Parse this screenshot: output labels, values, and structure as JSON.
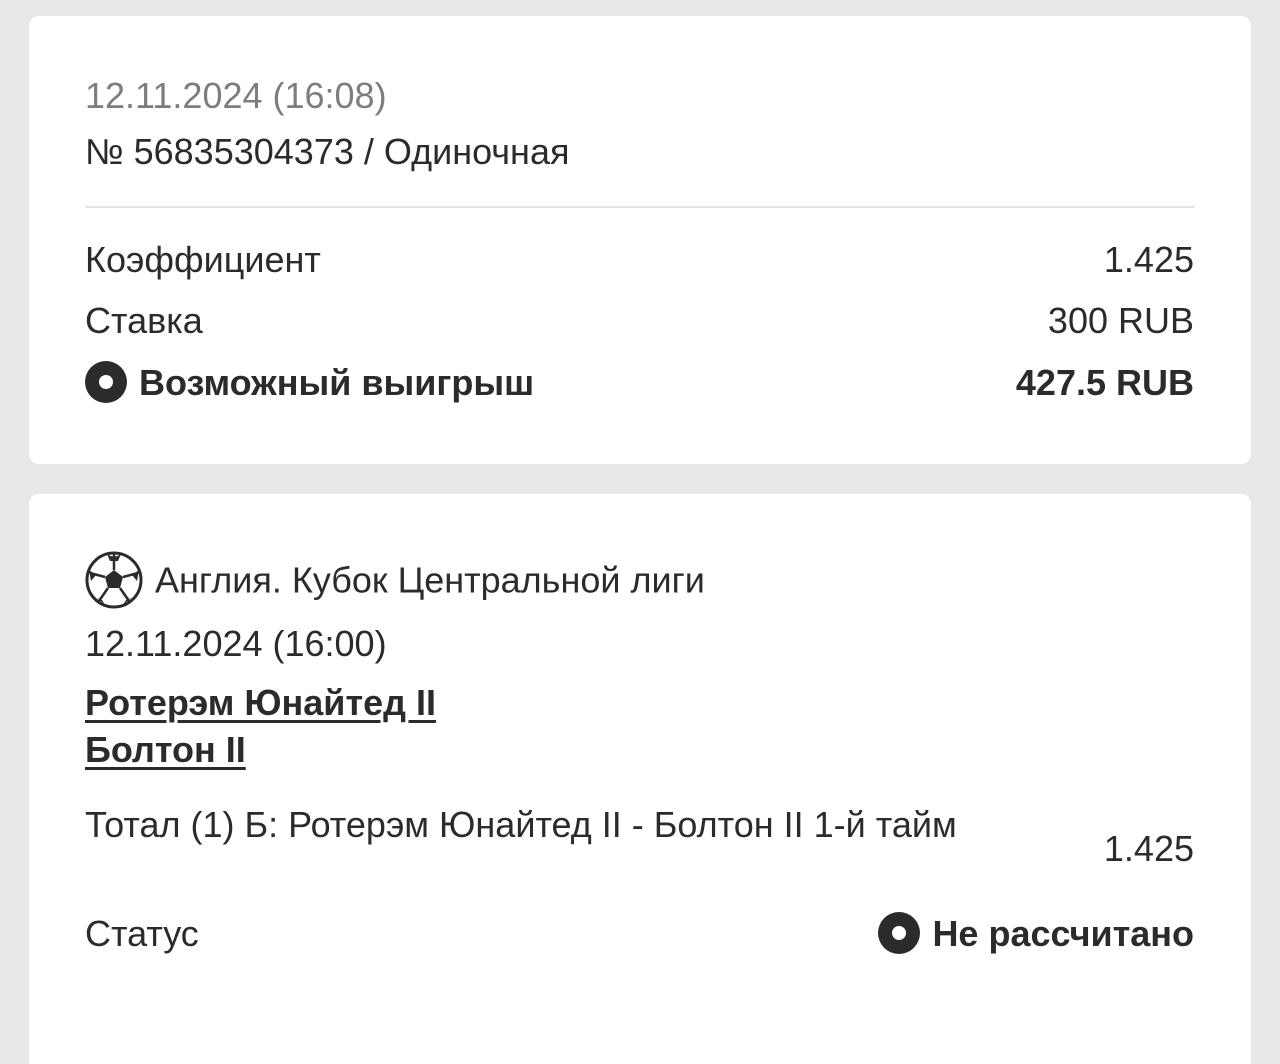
{
  "bet": {
    "datetime": "12.11.2024 (16:08)",
    "number_line": "№ 56835304373 / Одиночная",
    "coef_label": "Коэффициент",
    "coef_value": "1.425",
    "stake_label": "Ставка",
    "stake_value": "300 RUB",
    "win_label": "Возможный выигрыш",
    "win_value": "427.5 RUB"
  },
  "event": {
    "icon": "soccer-ball-icon",
    "league": "Англия. Кубок Центральной лиги",
    "datetime": "12.11.2024 (16:00)",
    "team1": "Ротерэм Юнайтед II",
    "team2": "Болтон II",
    "market": "Тотал (1) Б: Ротерэм Юнайтед II - Болтон II 1-й тайм",
    "market_coef": "1.425",
    "status_label": "Статус",
    "status_value": "Не рассчитано"
  },
  "colors": {
    "background": "#e8e8e8",
    "card": "#ffffff",
    "text": "#2b2b2b",
    "muted": "#7d7d7d"
  }
}
